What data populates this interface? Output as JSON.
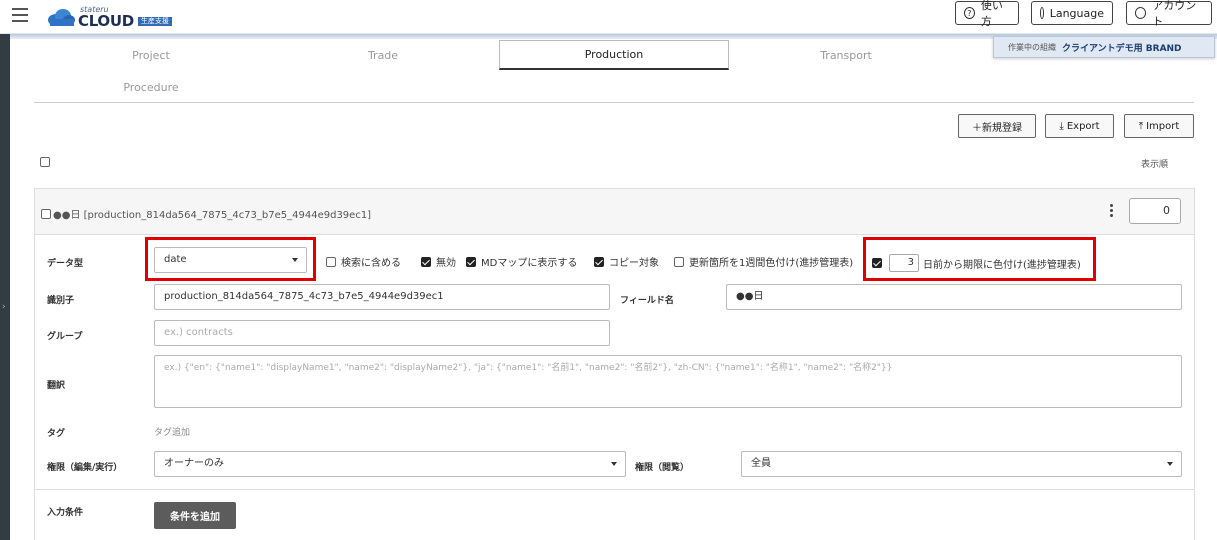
{
  "header": {
    "logo_small": "stateru",
    "logo_main": "CLOUD",
    "logo_badge": "生産支援",
    "help_label": "使い方",
    "language_label": "Language",
    "account_label": "アカウント"
  },
  "org": {
    "prefix": "作業中の組織",
    "name": "クライアントデモ用 BRAND"
  },
  "tabs": [
    {
      "label": "Project"
    },
    {
      "label": "Trade"
    },
    {
      "label": "Production"
    },
    {
      "label": "Transport"
    },
    {
      "label": "Procedure"
    }
  ],
  "actions": {
    "new_label": "＋新規登録",
    "export_label": "Export",
    "import_label": "Import"
  },
  "list": {
    "sort_label": "表示順"
  },
  "field": {
    "title": "●●日 [production_814da564_7875_4c73_b7e5_4944e9d39ec1]",
    "order": "0",
    "datatype_label": "データ型",
    "datatype_value": "date",
    "options": [
      {
        "label": "検索に含める",
        "checked": false
      },
      {
        "label": "無効",
        "checked": true
      },
      {
        "label": "MDマップに表示する",
        "checked": true
      },
      {
        "label": "コピー対象",
        "checked": true
      },
      {
        "label": "更新箇所を1週間色付け(進捗管理表)",
        "checked": false
      }
    ],
    "deadline_checked": true,
    "deadline_days": "3",
    "deadline_label": "日前から期限に色付け(進捗管理表)",
    "identifier_label": "識別子",
    "identifier_value": "production_814da564_7875_4c73_b7e5_4944e9d39ec1",
    "fieldname_label": "フィールド名",
    "fieldname_value": "●●日",
    "group_label": "グループ",
    "group_placeholder": "ex.) contracts",
    "translation_label": "翻訳",
    "translation_placeholder": "ex.) {\"en\": {\"name1\": \"displayName1\", \"name2\": \"displayName2\"}, \"ja\": {\"name1\": \"名前1\", \"name2\": \"名前2\"}, \"zh-CN\": {\"name1\": \"名称1\", \"name2\": \"名称2\"}}",
    "tag_label": "タグ",
    "tag_add": "タグ追加",
    "perm_edit_label": "権限（編集/実行）",
    "perm_edit_value": "オーナーのみ",
    "perm_view_label": "権限（閲覧）",
    "perm_view_value": "全員",
    "input_cond_label": "入力条件",
    "add_cond_label": "条件を追加"
  }
}
